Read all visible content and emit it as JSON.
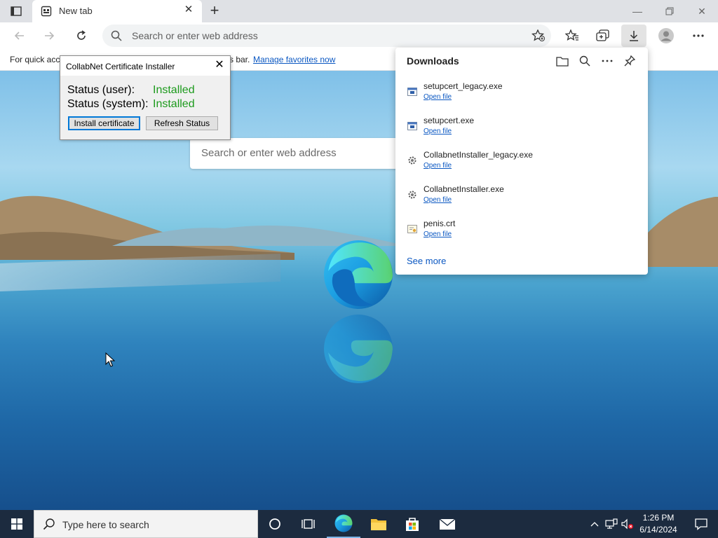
{
  "browser": {
    "tab_title": "New tab",
    "address_placeholder": "Search or enter web address"
  },
  "favorites_bar": {
    "text_start": "For quick acc",
    "text_end": "s bar.",
    "link": "Manage favorites now"
  },
  "ntp": {
    "search_placeholder": "Search or enter web address"
  },
  "dialog": {
    "title": "CollabNet Certificate Installer",
    "status_user_label": "Status (user):",
    "status_user_value": "Installed",
    "status_system_label": "Status (system):",
    "status_system_value": "Installed",
    "install_label": "Install certificate",
    "refresh_label": "Refresh Status",
    "status_color": "#1c9a1c"
  },
  "downloads": {
    "title": "Downloads",
    "items": [
      {
        "name": "setupcert_legacy.exe",
        "action": "Open file",
        "icon": "exe-icon"
      },
      {
        "name": "setupcert.exe",
        "action": "Open file",
        "icon": "exe-icon"
      },
      {
        "name": "CollabnetInstaller_legacy.exe",
        "action": "Open file",
        "icon": "installer-icon"
      },
      {
        "name": "CollabnetInstaller.exe",
        "action": "Open file",
        "icon": "installer-icon"
      },
      {
        "name": "penis.crt",
        "action": "Open file",
        "icon": "certificate-icon"
      }
    ],
    "see_more": "See more"
  },
  "taskbar": {
    "search_placeholder": "Type here to search",
    "time": "1:26 PM",
    "date": "6/14/2024"
  }
}
